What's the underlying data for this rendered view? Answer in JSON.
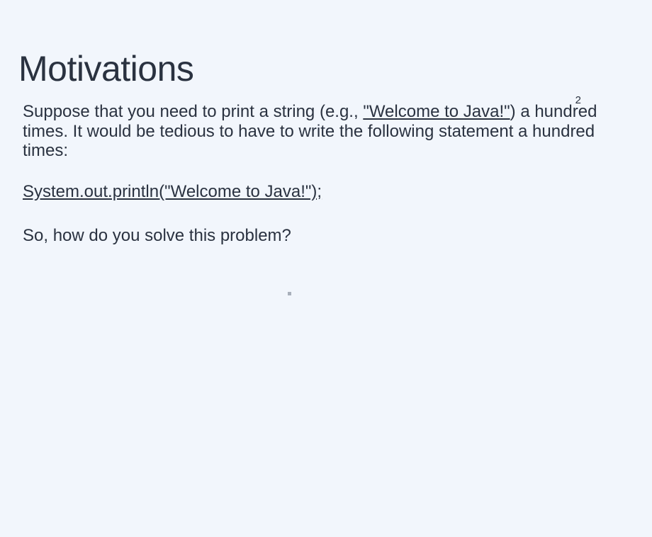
{
  "pageNumber": "2",
  "title": "Motivations",
  "paragraph1": {
    "pre": "Suppose that you need to print a string (e.g., ",
    "underlined": "\"Welcome to Java!\"",
    "post": ") a hundred times. It would be tedious to have to write the following statement a hundred times:"
  },
  "codeLine": "System.out.println(\"Welcome to Java!\");",
  "paragraph2": "So, how do you solve this problem?"
}
